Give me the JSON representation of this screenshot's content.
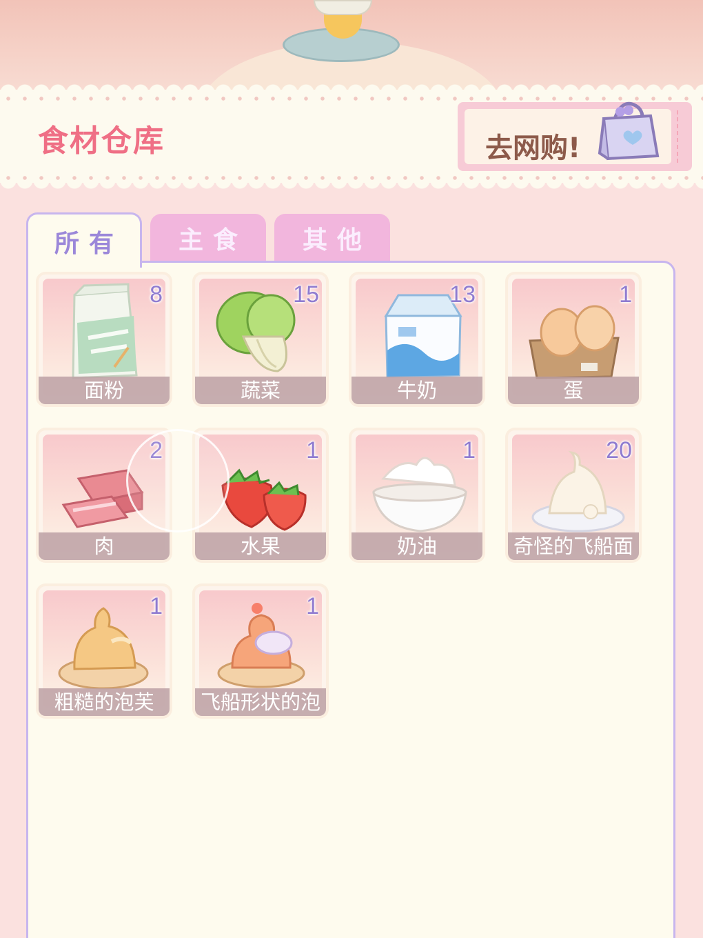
{
  "header": {
    "title": "食材仓库",
    "shop_button_label": "去网购!"
  },
  "tabs": [
    {
      "label": "所有",
      "active": true
    },
    {
      "label": "主食",
      "active": false
    },
    {
      "label": "其他",
      "active": false
    }
  ],
  "items": [
    {
      "name": "面粉",
      "count": "8",
      "icon": "flour-bag-icon"
    },
    {
      "name": "蔬菜",
      "count": "15",
      "icon": "cabbage-icon"
    },
    {
      "name": "牛奶",
      "count": "13",
      "icon": "milk-carton-icon"
    },
    {
      "name": "蛋",
      "count": "1",
      "icon": "egg-tray-icon"
    },
    {
      "name": "肉",
      "count": "2",
      "icon": "meat-icon"
    },
    {
      "name": "水果",
      "count": "1",
      "icon": "strawberry-icon"
    },
    {
      "name": "奶油",
      "count": "1",
      "icon": "cream-bowl-icon"
    },
    {
      "name": "奇怪的飞船面",
      "count": "20",
      "icon": "strange-dough-icon"
    },
    {
      "name": "粗糙的泡芙",
      "count": "1",
      "icon": "rough-puff-icon"
    },
    {
      "name": "飞船形状的泡",
      "count": "1",
      "icon": "ship-puff-icon"
    }
  ],
  "colors": {
    "title_pink": "#ef6f85",
    "tab_active_text": "#9b87d9",
    "tab_inactive_bg": "#f2b6dd",
    "count_purple": "#8f7bd0",
    "panel_border": "#c7b5ee"
  }
}
